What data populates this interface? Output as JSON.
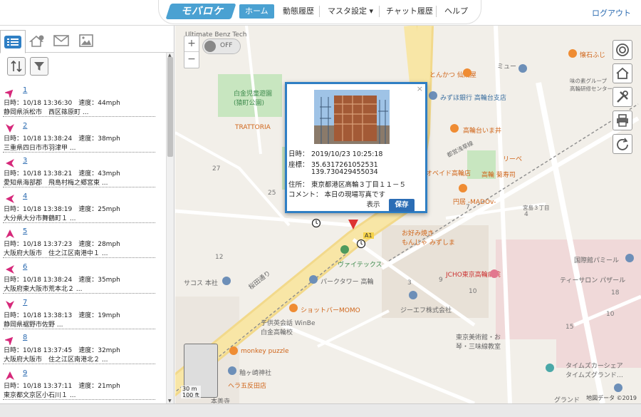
{
  "header": {
    "logo": "モバロケ",
    "nav": [
      {
        "label": "ホーム",
        "active": true
      },
      {
        "label": "動態履歴",
        "active": false
      },
      {
        "label": "マスタ設定 ▾",
        "active": false
      },
      {
        "label": "チャット履歴",
        "active": false
      },
      {
        "label": "ヘルプ",
        "active": false
      }
    ],
    "logout": "ログアウト"
  },
  "left_panel": {
    "tabs": [
      "list-icon",
      "house-location-icon",
      "mail-icon",
      "image-icon"
    ],
    "tools": [
      "sort-icon",
      "filter-icon"
    ],
    "items": [
      {
        "num": "1",
        "datetime": "日時：10/18 13:36:30",
        "speed": "速度：44mph",
        "address": "静岡県浜松市　西区篠原町 ...",
        "dir": "ne"
      },
      {
        "num": "2",
        "datetime": "日時：10/18 13:38:24",
        "speed": "速度：38mph",
        "address": "三重県四日市市羽津甲 ...",
        "dir": "s"
      },
      {
        "num": "3",
        "datetime": "日時：10/18 13:38:21",
        "speed": "速度：43mph",
        "address": "愛知県海部郡　飛島村梅之郷宮東 ...",
        "dir": "w"
      },
      {
        "num": "4",
        "datetime": "日時：10/18 13:38:19",
        "speed": "速度：25mph",
        "address": "大分県大分市舞鶴町１ ...",
        "dir": "w"
      },
      {
        "num": "5",
        "datetime": "日時：10/18 13:37:23",
        "speed": "速度：28mph",
        "address": "大阪府大阪市　住之江区南港中１ ...",
        "dir": "n"
      },
      {
        "num": "6",
        "datetime": "日時：10/18 13:38:24",
        "speed": "速度：35mph",
        "address": "大阪府東大阪市荒本北２ ...",
        "dir": "w"
      },
      {
        "num": "7",
        "datetime": "日時：10/18 13:38:13",
        "speed": "速度：19mph",
        "address": "静岡県裾野市佐野 ...",
        "dir": "s"
      },
      {
        "num": "8",
        "datetime": "日時：10/18 13:37:45",
        "speed": "速度：32mph",
        "address": "大阪府大阪市　住之江区南港北２ ...",
        "dir": "ne"
      },
      {
        "num": "9",
        "datetime": "日時：10/18 13:37:11",
        "speed": "速度：21mph",
        "address": "東京都文京区小石川１ ...",
        "dir": "n"
      }
    ]
  },
  "map": {
    "toggle": "OFF",
    "zoom_in": "+",
    "zoom_out": "−",
    "scale_m": "30 m",
    "scale_ft": "100 ft",
    "copyright": "地図データ ©2019",
    "right_tools": [
      "target-icon",
      "home-icon",
      "tools-icon",
      "print-icon",
      "refresh-icon"
    ],
    "labels": {
      "benz": "Ultimate Benz Tech",
      "park": "白金児童遊園\n(猿町公園)",
      "trattoria": "TRATTORIA",
      "hifumi": "懐石ふじ",
      "bento": "とんかつ 仙成屋",
      "mizuho": "みずほ銀行 高輪台支店",
      "miyuu": "ミュー",
      "group": "味の素グループ\n高輪研修センター",
      "takanawaumai": "高輪台いま井",
      "toei": "都営浅草線",
      "libe": "リーベ",
      "obeido": "オベイド高輪店",
      "takanawaen": "高輪 菊寿司",
      "enkyo": "円居 -MADOv-",
      "address3": "宮島３丁目",
      "sakurada": "桜田通り",
      "vtex": "ヴァイテックス",
      "park_tower": "パークタワー 高輪",
      "okonomi": "お好み焼き\nもんじゃ みずしま",
      "jcho": "JCHO東京高輪病院",
      "kokusai": "国際館パミール",
      "tisalon": "ティーサロン パザール",
      "sako": "サコス 本社",
      "shotbar": "ショットバーMOMO",
      "kodomo": "子供英会話 WinBe\n白金高輪校",
      "gf": "ジーエフ株式会社",
      "shogi": "東京美術館・お\n琴・三味線教室",
      "monkey": "monkey puzzle",
      "shrine": "釉ヶ崎神社",
      "gotanda": "ヘラ五反田店",
      "honkyo": "本善寺",
      "times": "タイムズカーシェア\nタイムズグランド…",
      "grand": "グランド",
      "a1": "A1"
    },
    "numbers": [
      "27",
      "25",
      "10",
      "3",
      "9",
      "7",
      "4",
      "15",
      "10",
      "18",
      "12"
    ]
  },
  "popup": {
    "close": "×",
    "datetime_key": "日時：",
    "datetime": "2019/10/23 10:25:18",
    "coord_key": "座標：",
    "lat": "35.6317261052531",
    "lng": "139.730429455034",
    "address_key": "住所：",
    "address": "東京都港区高輪３丁目１１－５",
    "comment_key": "コメント：",
    "comment": "本日の現場写真です",
    "show_button": "表示",
    "save_button": "保存"
  },
  "colors": {
    "accent": "#4aa1d2",
    "popup_border": "#2f7fc4",
    "arrow": "#d6287a"
  }
}
